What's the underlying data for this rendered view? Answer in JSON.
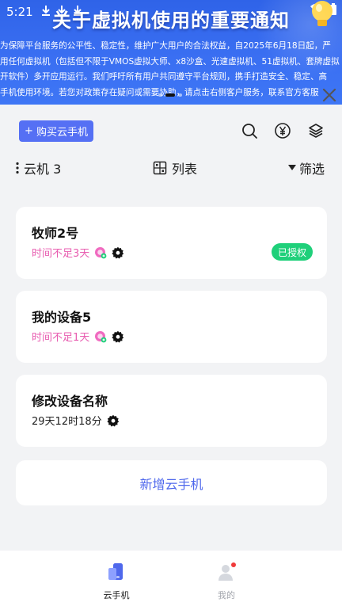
{
  "status_bar": {
    "time": "5:21"
  },
  "banner": {
    "title": "关于虚拟机使用的重要通知",
    "lines": [
      "为保障平台服务的公平性、稳定性，维护广大用户的合法权益，自2025年6月18日起，严",
      "用任何虚拟机（包括但不限于VMOS虚拟大师、x8沙盒、光速虚拟机、51虚拟机、套牌虚拟",
      "开软件）多开应用运行。我们呼吁所有用户共同遵守平台规则，携手打造安全、稳定、高",
      "手机使用环境。若您对政策存在疑问或需要协助，请点击右侧客户服务，联系官方客服"
    ]
  },
  "toolbar": {
    "buy_label": "购买云手机",
    "buy_prefix": "+"
  },
  "filter_bar": {
    "group_label": "云机 3",
    "view_label": "列表",
    "filter_label": "筛选"
  },
  "devices": [
    {
      "name": "牧师2号",
      "time": "时间不足3天",
      "badge": "已授权"
    },
    {
      "name": "我的设备5",
      "time": "时间不足1天"
    },
    {
      "name": "修改设备名称",
      "time": "29天12时18分"
    }
  ],
  "add_device_label": "新增云手机",
  "bottom_nav": [
    {
      "label": "云手机"
    },
    {
      "label": "我的"
    }
  ],
  "colors": {
    "accent": "#5570f4",
    "warning_text": "#e85db0",
    "authorized_badge": "#1fd07a",
    "banner_blue": "#3a6ff2"
  }
}
